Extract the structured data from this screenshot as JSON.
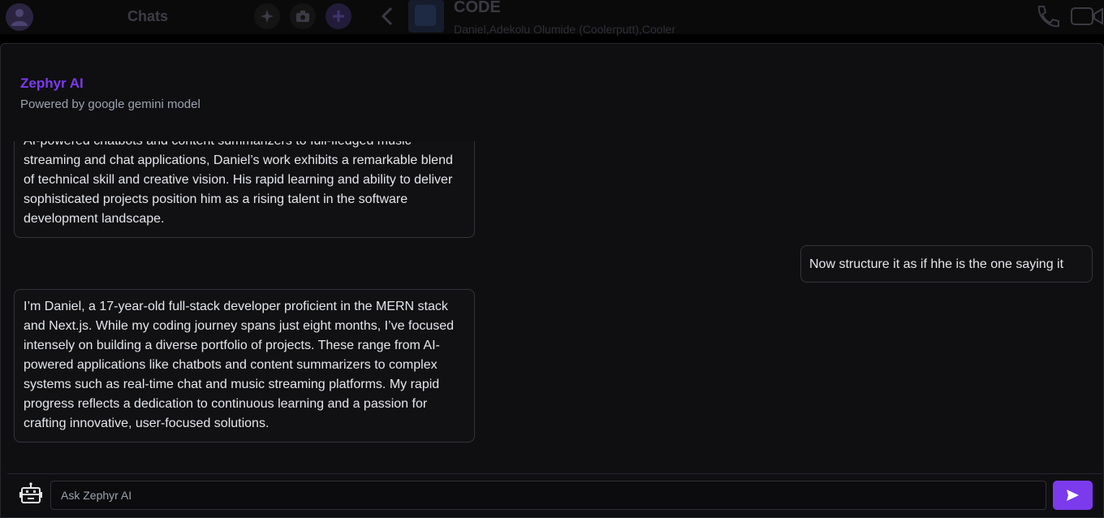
{
  "background": {
    "sidebar_title": "Chats",
    "chat_title": "CODE",
    "chat_members": "Daniel,Adekolu Olumide (Coolerputt),Cooler"
  },
  "assistant": {
    "name": "Zephyr AI",
    "subtitle": "Powered by google gemini model"
  },
  "messages": [
    {
      "role": "ai",
      "text": "AI-powered chatbots and content summarizers to full-fledged music streaming and chat applications, Daniel’s work exhibits a remarkable blend of technical skill and creative vision. His rapid learning and ability to deliver sophisticated projects position him as a rising talent in the software development landscape."
    },
    {
      "role": "user",
      "text": "Now structure it as if hhe is the one saying it"
    },
    {
      "role": "ai",
      "text": "I’m Daniel, a 17-year-old full-stack developer proficient in the MERN stack and Next.js. While my coding journey spans just eight months, I’ve focused intensely on building a diverse portfolio of projects. These range from AI-powered applications like chatbots and content summarizers to complex systems such as real-time chat and music streaming platforms. My rapid progress reflects a dedication to continuous learning and a passion for crafting innovative, user-focused solutions."
    }
  ],
  "composer": {
    "placeholder": "Ask Zephyr AI",
    "value": ""
  },
  "icons": {
    "bot": "robot-icon",
    "send": "send-icon"
  },
  "colors": {
    "accent": "#7c3aed",
    "background": "#0f0f12"
  }
}
